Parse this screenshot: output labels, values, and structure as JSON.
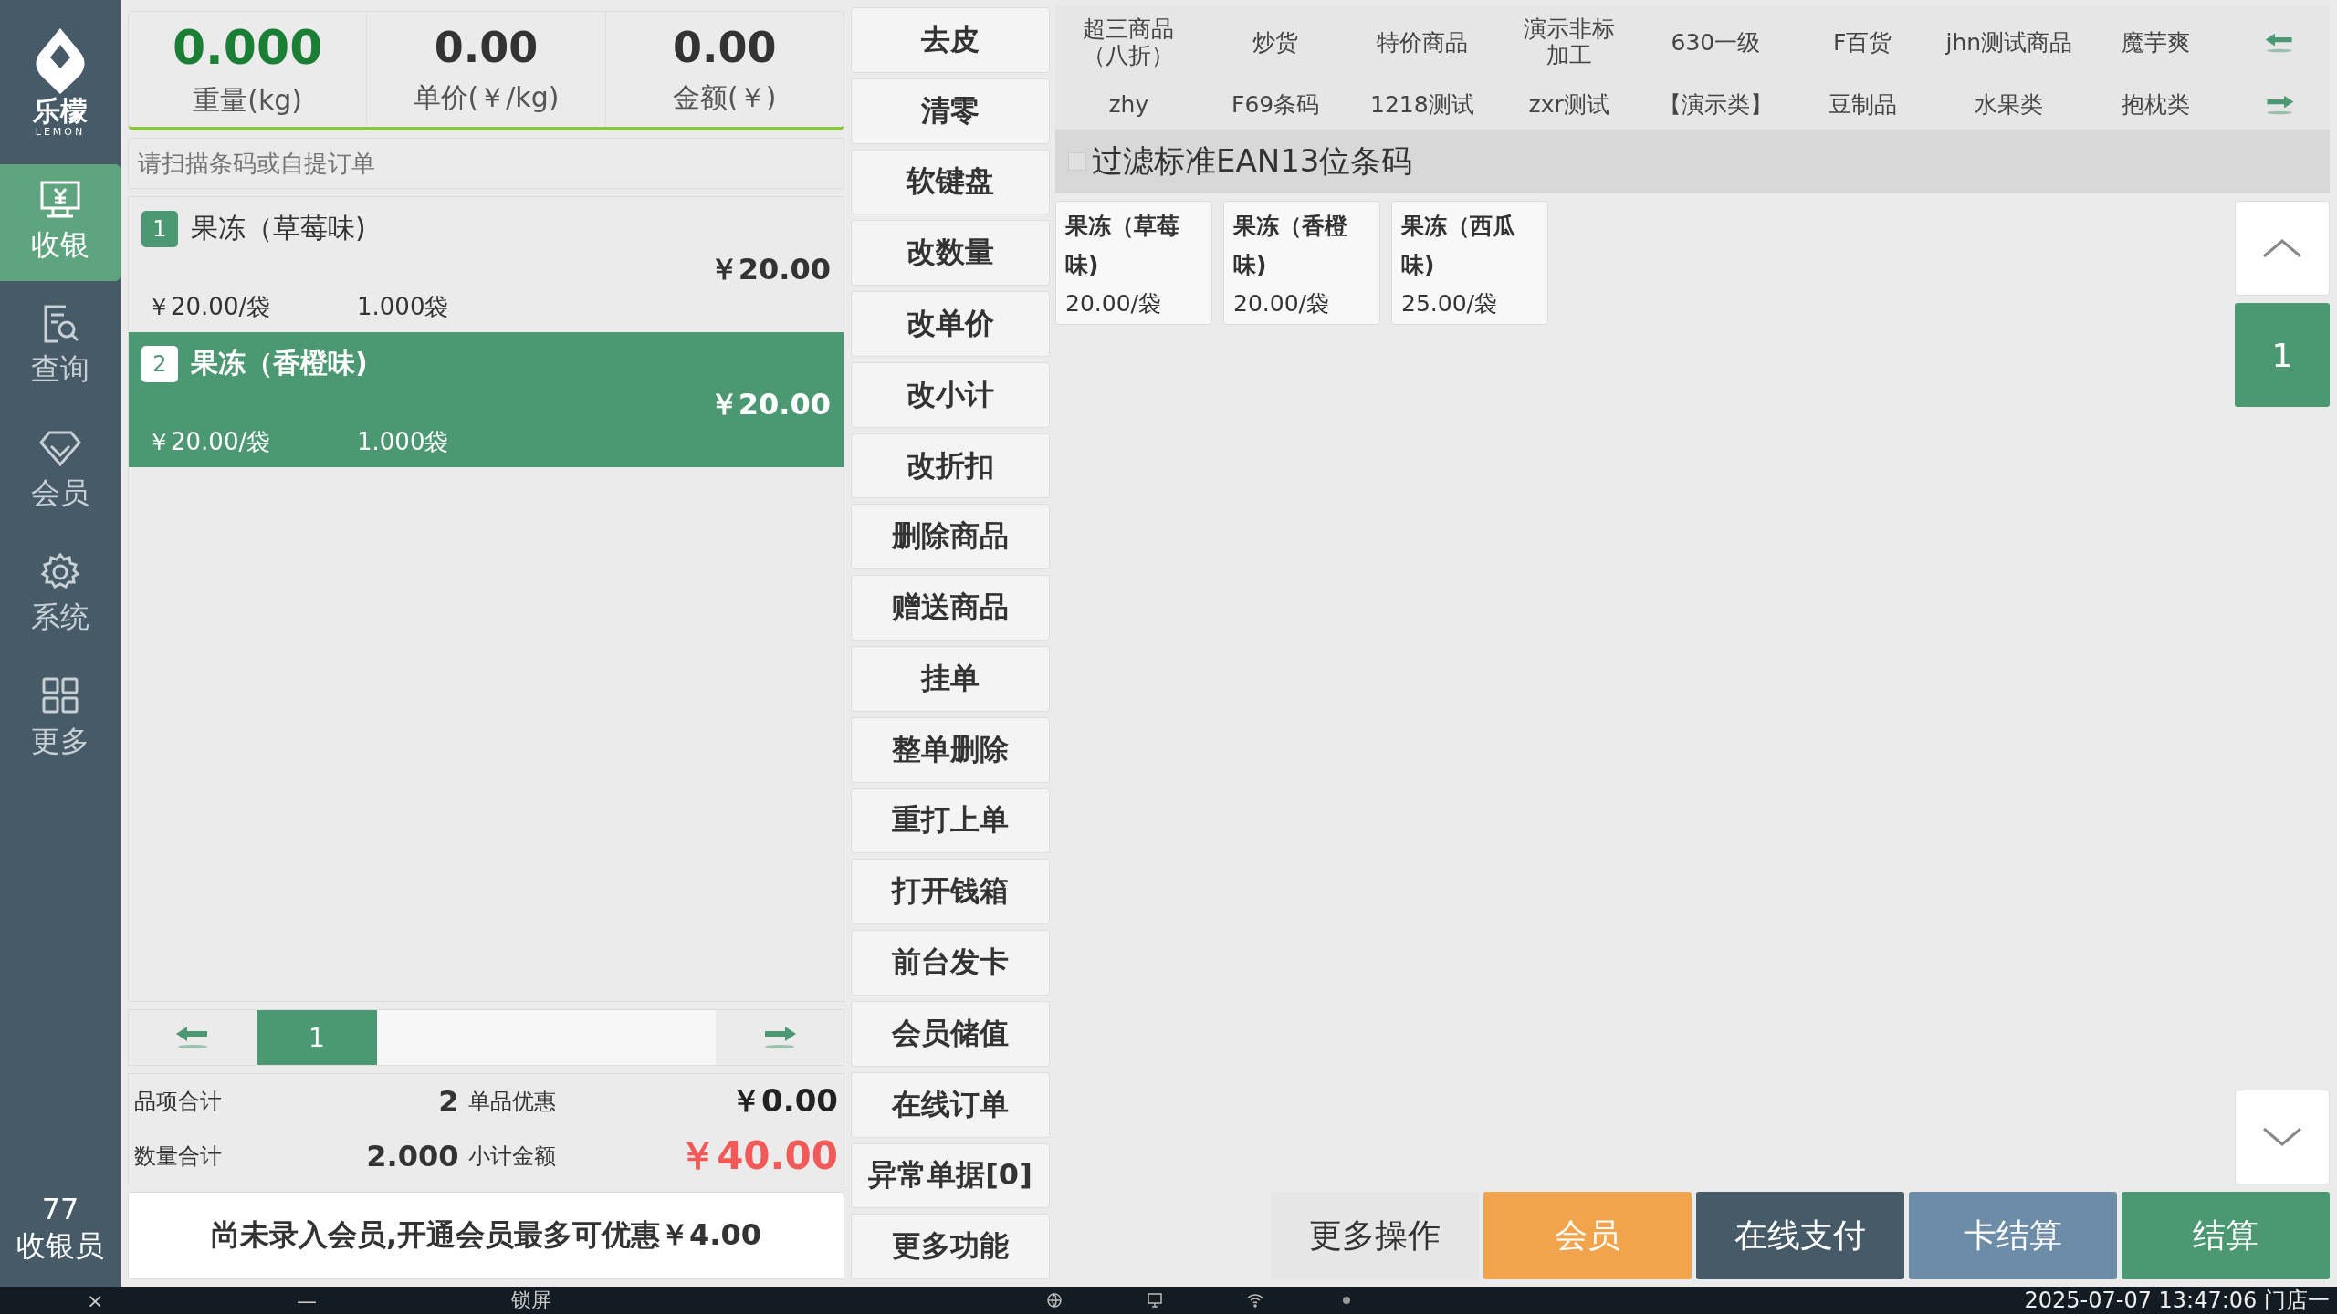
{
  "logo": {
    "name": "乐檬",
    "subtitle": "LEMON"
  },
  "sidebar": {
    "items": [
      {
        "label": "收银",
        "kind": "cashier",
        "selected": true
      },
      {
        "label": "查询",
        "kind": "query",
        "selected": false
      },
      {
        "label": "会员",
        "kind": "member",
        "selected": false
      },
      {
        "label": "系统",
        "kind": "system",
        "selected": false
      },
      {
        "label": "更多",
        "kind": "more",
        "selected": false
      }
    ],
    "operator": {
      "id": "77",
      "role": "收银员"
    }
  },
  "scale": [
    {
      "value": "0.000",
      "label": "重量(kg)",
      "highlight": true
    },
    {
      "value": "0.00",
      "label": "单价(￥/kg)",
      "highlight": false
    },
    {
      "value": "0.00",
      "label": "金额(￥)",
      "highlight": false
    }
  ],
  "search": {
    "placeholder": "请扫描条码或自提订单"
  },
  "cart": [
    {
      "index": "1",
      "name": "果冻（草莓味)",
      "amount": "￥20.00",
      "unit_price": "￥20.00/袋",
      "quantity": "1.000袋",
      "selected": false
    },
    {
      "index": "2",
      "name": "果冻（香橙味)",
      "amount": "￥20.00",
      "unit_price": "￥20.00/袋",
      "quantity": "1.000袋",
      "selected": true
    }
  ],
  "cart_pages": [
    {
      "label": "1",
      "selected": true
    }
  ],
  "totals": [
    {
      "label": "品项合计",
      "value": "2",
      "label2": "单品优惠",
      "value2": "￥0.00",
      "alert": false
    },
    {
      "label": "数量合计",
      "value": "2.000",
      "label2": "小计金额",
      "value2": "￥40.00",
      "alert": true
    }
  ],
  "member_banner": "尚未录入会员,开通会员最多可优惠￥4.00",
  "actions": [
    "去皮",
    "清零",
    "软键盘",
    "改数量",
    "改单价",
    "改小计",
    "改折扣",
    "删除商品",
    "赠送商品",
    "挂单",
    "整单删除",
    "重打上单",
    "打开钱箱",
    "前台发卡",
    "会员储值",
    "在线订单",
    "异常单据[0]",
    "更多功能"
  ],
  "categories": [
    [
      "超三商品（八折）",
      "炒货",
      "特价商品",
      "演示非标加工",
      "630一级",
      "F百货",
      "jhn测试商品",
      "魔芋爽"
    ],
    [
      "zhy",
      "F69条码",
      "1218测试",
      "zxr测试",
      "【演示类】",
      "豆制品",
      "水果类",
      "抱枕类"
    ]
  ],
  "filter": {
    "label": "过滤标准EAN13位条码",
    "checked": false
  },
  "products": [
    {
      "name": "果冻（草莓味)",
      "price": "20.00/袋"
    },
    {
      "name": "果冻（香橙味)",
      "price": "20.00/袋"
    },
    {
      "name": "果冻（西瓜味)",
      "price": "25.00/袋"
    }
  ],
  "product_pages": [
    {
      "label": "1",
      "selected": true
    }
  ],
  "bottom_buttons": [
    {
      "label": "更多操作",
      "kind": "plain"
    },
    {
      "label": "会员",
      "kind": "member"
    },
    {
      "label": "在线支付",
      "kind": "online"
    },
    {
      "label": "卡结算",
      "kind": "card"
    },
    {
      "label": "结算",
      "kind": "checkout"
    }
  ],
  "taskbar": {
    "close": "×",
    "minimize": "—",
    "lock": "锁屏",
    "datetime": "2025-07-07 13:47:06 门店一"
  }
}
